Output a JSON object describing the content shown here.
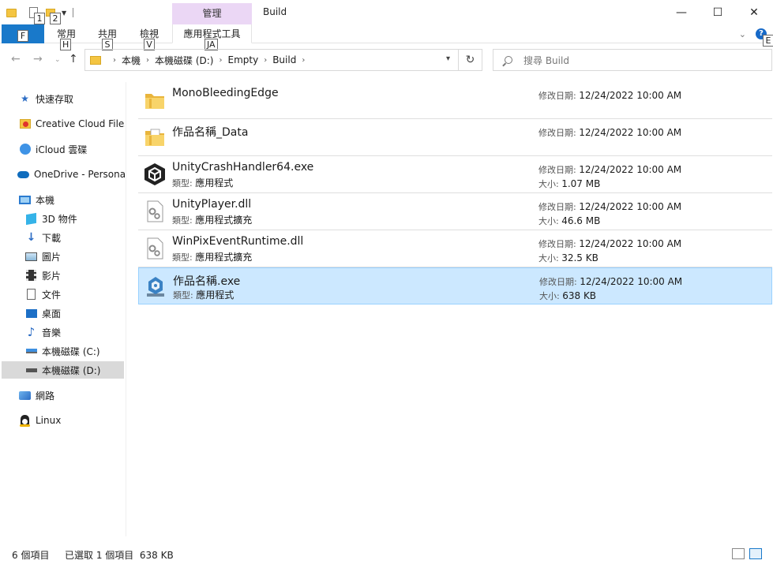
{
  "window": {
    "title": "Build",
    "context_tab_header": "管理",
    "controls": {
      "minimize": "—",
      "maximize": "☐",
      "close": "✕"
    }
  },
  "quick_access": {
    "keytips": [
      "F",
      "1",
      "2"
    ]
  },
  "ribbon": {
    "tabs": [
      {
        "label": "常用",
        "keytip": "H"
      },
      {
        "label": "共用",
        "keytip": "S"
      },
      {
        "label": "檢視",
        "keytip": "V"
      },
      {
        "label": "應用程式工具",
        "keytip": "JA"
      }
    ],
    "help_keytip": "E"
  },
  "address": {
    "breadcrumbs": [
      "本機",
      "本機磁碟 (D:)",
      "Empty",
      "Build"
    ]
  },
  "search": {
    "placeholder": "搜尋 Build"
  },
  "nav_pane": {
    "items": [
      {
        "label": "快速存取",
        "icon": "star-icon"
      },
      {
        "label": "Creative Cloud Files",
        "icon": "creative-cloud-icon"
      },
      {
        "label": "iCloud 雲碟",
        "icon": "icloud-icon"
      },
      {
        "label": "OneDrive - Personal",
        "icon": "onedrive-icon"
      },
      {
        "label": "本機",
        "icon": "computer-icon"
      },
      {
        "label": "3D 物件",
        "icon": "3d-objects-icon"
      },
      {
        "label": "下載",
        "icon": "download-icon"
      },
      {
        "label": "圖片",
        "icon": "pictures-icon"
      },
      {
        "label": "影片",
        "icon": "videos-icon"
      },
      {
        "label": "文件",
        "icon": "documents-icon"
      },
      {
        "label": "桌面",
        "icon": "desktop-icon"
      },
      {
        "label": "音樂",
        "icon": "music-icon"
      },
      {
        "label": "本機磁碟 (C:)",
        "icon": "drive-c-icon"
      },
      {
        "label": "本機磁碟 (D:)",
        "icon": "drive-d-icon"
      },
      {
        "label": "網路",
        "icon": "network-icon"
      },
      {
        "label": "Linux",
        "icon": "linux-icon"
      }
    ]
  },
  "labels": {
    "date": "修改日期:",
    "type": "類型:",
    "size": "大小:"
  },
  "files": [
    {
      "name": "MonoBleedingEdge",
      "kind": "folder",
      "date": "12/24/2022 10:00 AM"
    },
    {
      "name": "作品名稱_Data",
      "kind": "folder-doc",
      "date": "12/24/2022 10:00 AM"
    },
    {
      "name": "UnityCrashHandler64.exe",
      "kind": "unity",
      "type": "應用程式",
      "date": "12/24/2022 10:00 AM",
      "size": "1.07 MB"
    },
    {
      "name": "UnityPlayer.dll",
      "kind": "dll",
      "type": "應用程式擴充",
      "date": "12/24/2022 10:00 AM",
      "size": "46.6 MB"
    },
    {
      "name": "WinPixEventRuntime.dll",
      "kind": "dll",
      "type": "應用程式擴充",
      "date": "12/24/2022 10:00 AM",
      "size": "32.5 KB"
    },
    {
      "name": "作品名稱.exe",
      "kind": "unity-app",
      "type": "應用程式",
      "date": "12/24/2022 10:00 AM",
      "size": "638 KB"
    }
  ],
  "status": {
    "count": "6 個項目",
    "selection": "已選取 1 個項目  638 KB"
  },
  "colors": {
    "accent": "#1979ca",
    "selection": "#cce8ff",
    "context_tab": "#ebd7f5"
  }
}
